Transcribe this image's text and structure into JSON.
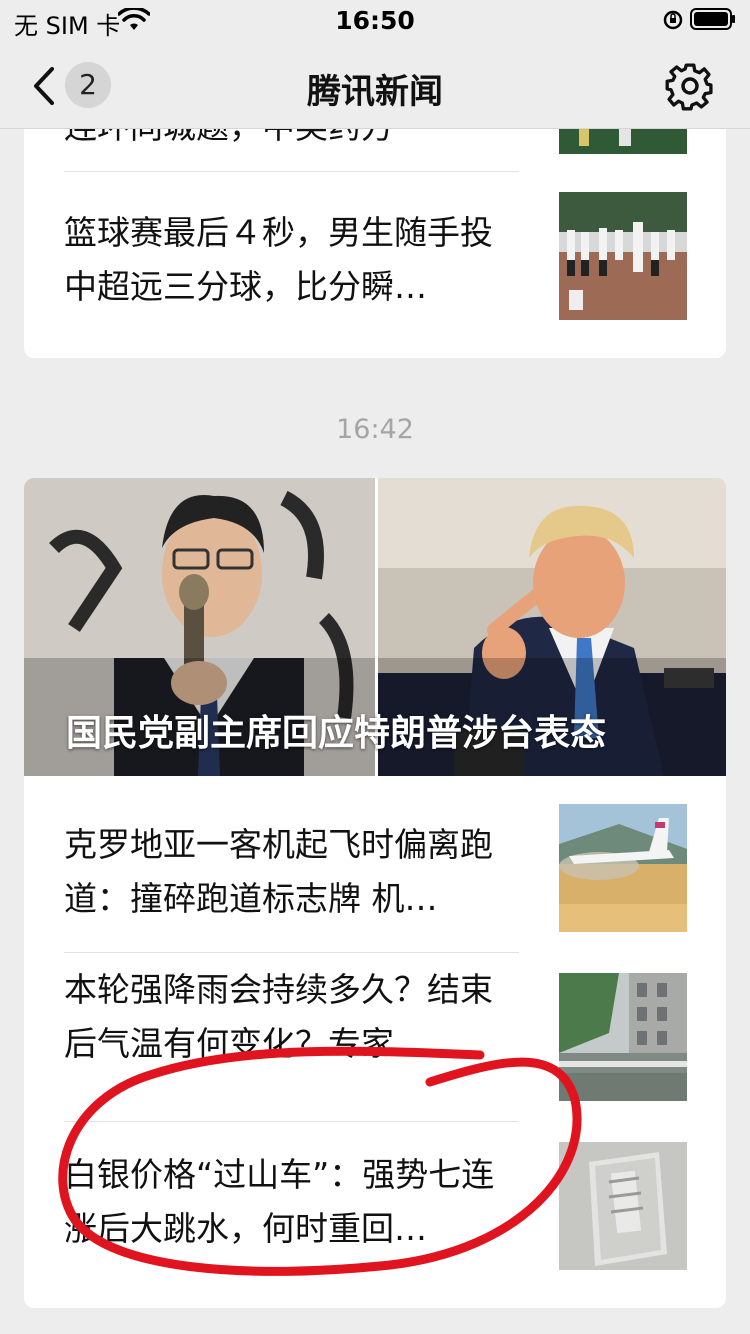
{
  "status_bar": {
    "carrier": "无 SIM 卡",
    "time": "16:50"
  },
  "nav": {
    "badge": "2",
    "title": "腾讯新闻"
  },
  "first_card": {
    "partial_title": "连环同城题，中奖药方",
    "item_title": "篮球赛最后４秒，男生随手投中超远三分球，比分瞬…"
  },
  "timestamp": "16:42",
  "second_card": {
    "hero_caption": "国民党副主席回应特朗普涉台表态",
    "items": [
      {
        "title": "克罗地亚一客机起飞时偏离跑道：撞碎跑道标志牌 机…"
      },
      {
        "title": "本轮强降雨会持续多久？结束后气温有何变化？专家…"
      },
      {
        "title": "白银价格“过山车”：强势七连涨后大跳水，何时重回…"
      }
    ]
  },
  "colors": {
    "annotation": "#e0141e",
    "background": "#ededed"
  }
}
